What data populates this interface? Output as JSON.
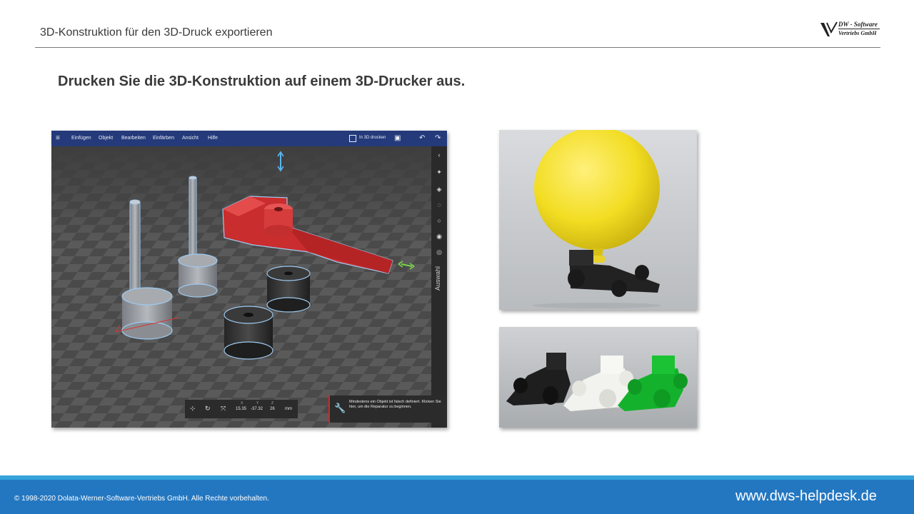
{
  "header": {
    "title": "3D-Konstruktion für den 3D-Druck exportieren",
    "logo_line1": "DW - Software",
    "logo_line2": "Vertriebs GmbH"
  },
  "slide": {
    "heading": "Drucken Sie die 3D-Konstruktion auf einem 3D-Drucker aus."
  },
  "app": {
    "menu": [
      "Einfügen",
      "Objekt",
      "Bearbeiten",
      "Einfärben",
      "Ansicht",
      "Hilfe"
    ],
    "print_label": "In 3D drucken",
    "side_panel_label": "Auswahl",
    "coords": {
      "x_label": "X",
      "y_label": "Y",
      "z_label": "Z",
      "x": "15.35",
      "y": "-37.32",
      "z": "26",
      "unit": "mm"
    },
    "notice": "Mindestens ein Objekt ist falsch definiert. Klicken Sie hier, um die Reparatur zu beginnen.",
    "colors": {
      "menubar": "#243a7a",
      "selection": "#9ec9f0",
      "part": "#e03a3a"
    },
    "icons": [
      "hamburger-icon",
      "print-3d-icon",
      "save-icon",
      "undo-icon",
      "redo-icon",
      "wrench-icon"
    ]
  },
  "footer": {
    "copyright": "© 1998-2020 Dolata-Werner-Software-Vertriebs GmbH. Alle Rechte vorbehalten.",
    "website": "www.dws-helpdesk.de",
    "colors": {
      "bar": "#2377c1",
      "accent": "#37a3dc"
    }
  }
}
